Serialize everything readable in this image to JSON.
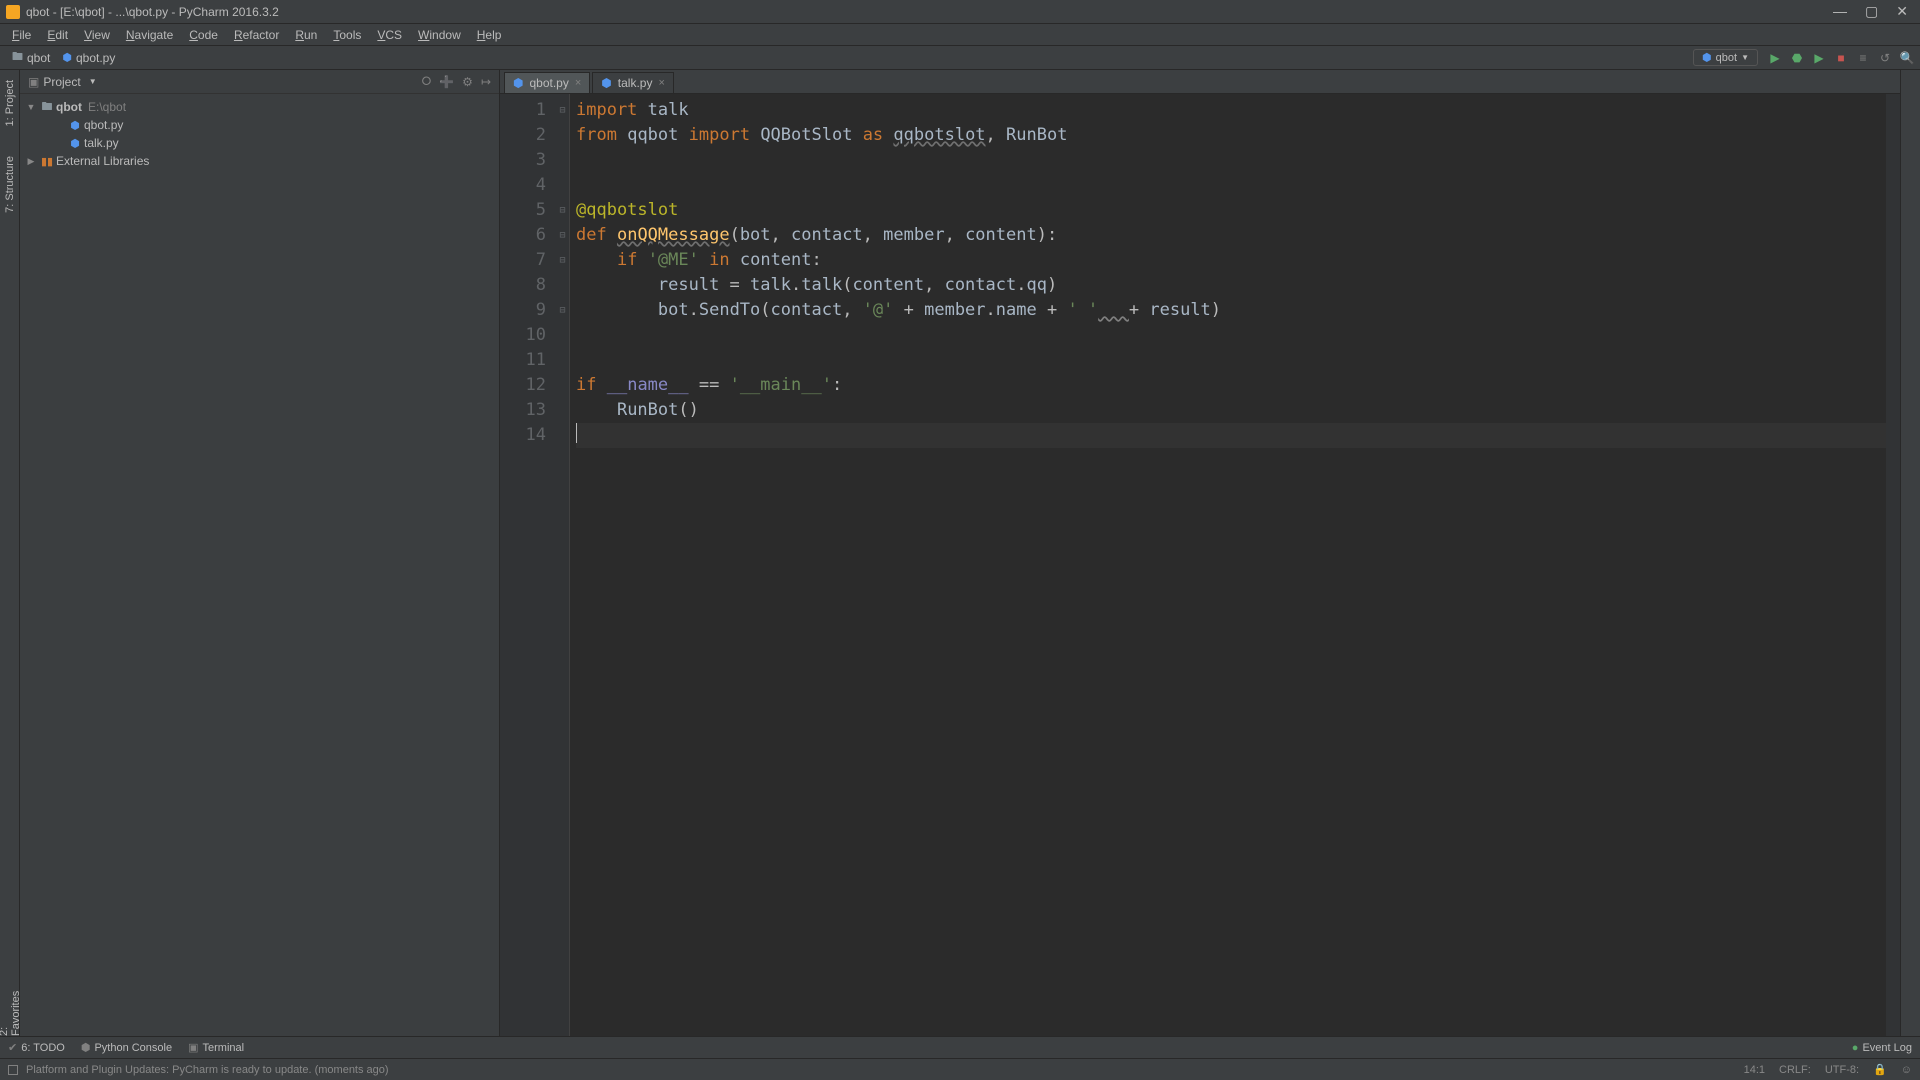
{
  "title": "qbot - [E:\\qbot] - ...\\qbot.py - PyCharm 2016.3.2",
  "menu": [
    "File",
    "Edit",
    "View",
    "Navigate",
    "Code",
    "Refactor",
    "Run",
    "Tools",
    "VCS",
    "Window",
    "Help"
  ],
  "breadcrumb": {
    "folder": "qbot",
    "file": "qbot.py"
  },
  "run_config": "qbot",
  "left_tabs": [
    "1: Project",
    "7: Structure"
  ],
  "right_tabs": [
    "2: Favorites"
  ],
  "sidebar": {
    "header": "Project",
    "root": {
      "name": "qbot",
      "path": "E:\\qbot"
    },
    "files": [
      "qbot.py",
      "talk.py"
    ],
    "libs": "External Libraries"
  },
  "tabs": [
    {
      "label": "qbot.py",
      "active": true
    },
    {
      "label": "talk.py",
      "active": false
    }
  ],
  "code_html": [
    "<span class='kw'>import</span> <span class='ident'>talk</span>",
    "<span class='kw'>from</span> <span class='ident'>qqbot</span> <span class='kw'>import</span> <span class='ident'>QQBotSlot</span> <span class='kw'>as</span> <span class='ident usq'>qqbotslot</span>, <span class='ident'>RunBot</span>",
    "",
    "",
    "<span class='dec'>@qqbotslot</span>",
    "<span class='kw'>def</span> <span class='fn usq'>onQQMessage</span>(<span class='ident'>bot</span>, <span class='ident'>contact</span>, <span class='ident'>member</span>, <span class='ident'>content</span>):",
    "    <span class='kw'>if</span> <span class='str'>'@ME'</span> <span class='kw'>in</span> <span class='ident'>content</span>:",
    "        <span class='ident'>result</span> = <span class='ident'>talk</span>.<span class='ident'>talk</span>(<span class='ident'>content</span>, <span class='ident'>contact</span>.<span class='ident'>qq</span>)",
    "        <span class='ident'>bot</span>.<span class='ident'>SendTo</span>(<span class='ident'>contact</span>, <span class='str'>'@'</span> + <span class='ident'>member</span>.<span class='ident'>name</span> + <span class='str'>' '</span><span class='warn'>   </span>+ <span class='ident'>result</span>)",
    "",
    "",
    "<span class='kw'>if</span> <span class='builtin'>__name__</span> == <span class='str'>'__main__'</span>:",
    "    <span class='ident'>RunBot</span>()",
    ""
  ],
  "line_count": 14,
  "bottom": {
    "todo": "6: TODO",
    "console": "Python Console",
    "terminal": "Terminal",
    "eventlog": "Event Log"
  },
  "status": {
    "msg": "Platform and Plugin Updates: PyCharm is ready to update. (moments ago)",
    "pos": "14:1",
    "le": "CRLF:",
    "enc": "UTF-8:"
  }
}
